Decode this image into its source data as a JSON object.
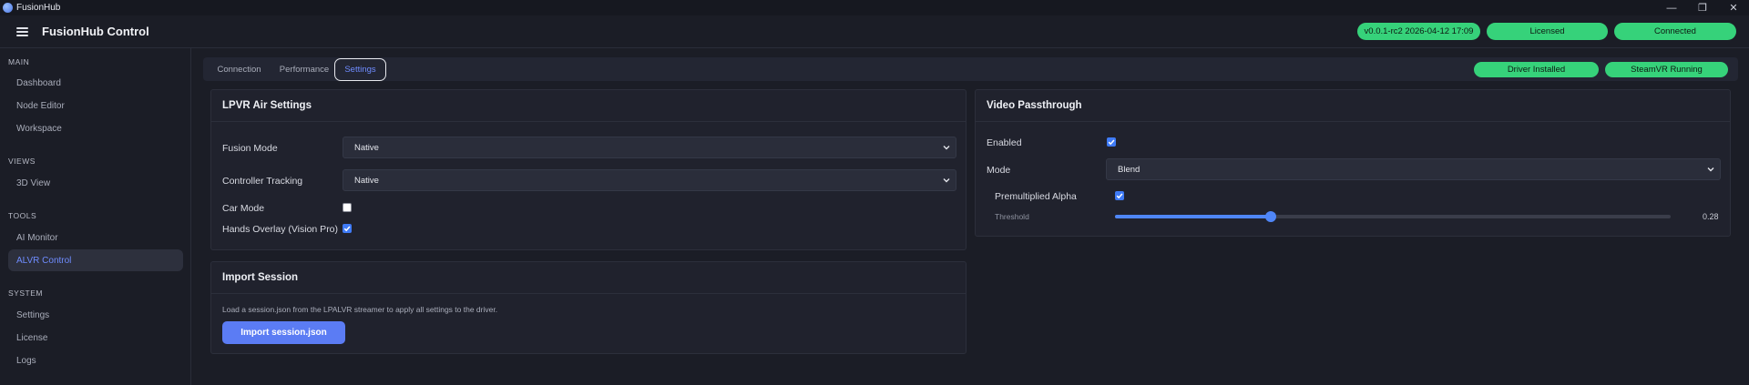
{
  "window": {
    "title": "FusionHub",
    "controls": [
      "—",
      "❐",
      "✕"
    ]
  },
  "header": {
    "title": "FusionHub Control",
    "badges": [
      {
        "label": "v0.0.1-rc2 2026-04-12 17:09"
      },
      {
        "label": "Licensed"
      },
      {
        "label": "Connected"
      }
    ]
  },
  "sidebar": {
    "sections": [
      {
        "label": "MAIN",
        "items": [
          "Dashboard",
          "Node Editor",
          "Workspace"
        ]
      },
      {
        "label": "VIEWS",
        "items": [
          "3D View"
        ]
      },
      {
        "label": "TOOLS",
        "items": [
          "AI Monitor",
          "ALVR Control"
        ]
      },
      {
        "label": "SYSTEM",
        "items": [
          "Settings",
          "License",
          "Logs"
        ]
      }
    ],
    "active_item": "ALVR Control"
  },
  "tabs": [
    {
      "label": "Connection"
    },
    {
      "label": "Performance"
    },
    {
      "label": "Settings",
      "active": true
    }
  ],
  "status_badges": [
    {
      "label": "Driver Installed"
    },
    {
      "label": "SteamVR Running"
    }
  ],
  "lpvr": {
    "title": "LPVR Air Settings",
    "fusion_mode": {
      "label": "Fusion Mode",
      "value": "Native"
    },
    "controller_tracking": {
      "label": "Controller Tracking",
      "value": "Native"
    },
    "car_mode": {
      "label": "Car Mode",
      "checked": false
    },
    "hands_overlay": {
      "label": "Hands Overlay (Vision Pro)",
      "checked": true
    }
  },
  "import_session": {
    "title": "Import Session",
    "description": "Load a session.json from the LPALVR streamer to apply all settings to the driver.",
    "button_label": "Import session.json"
  },
  "video_passthrough": {
    "title": "Video Passthrough",
    "enabled": {
      "label": "Enabled",
      "checked": true
    },
    "mode": {
      "label": "Mode",
      "value": "Blend"
    },
    "premultiplied_alpha": {
      "label": "Premultiplied Alpha",
      "checked": true
    },
    "threshold": {
      "label": "Threshold",
      "value": 0.28,
      "value_text": "0.28"
    }
  },
  "colors": {
    "accent": "#6f8cff",
    "success": "#36d27a",
    "primary_button": "#5b7cf4",
    "checkbox": "#3f7bf6"
  }
}
